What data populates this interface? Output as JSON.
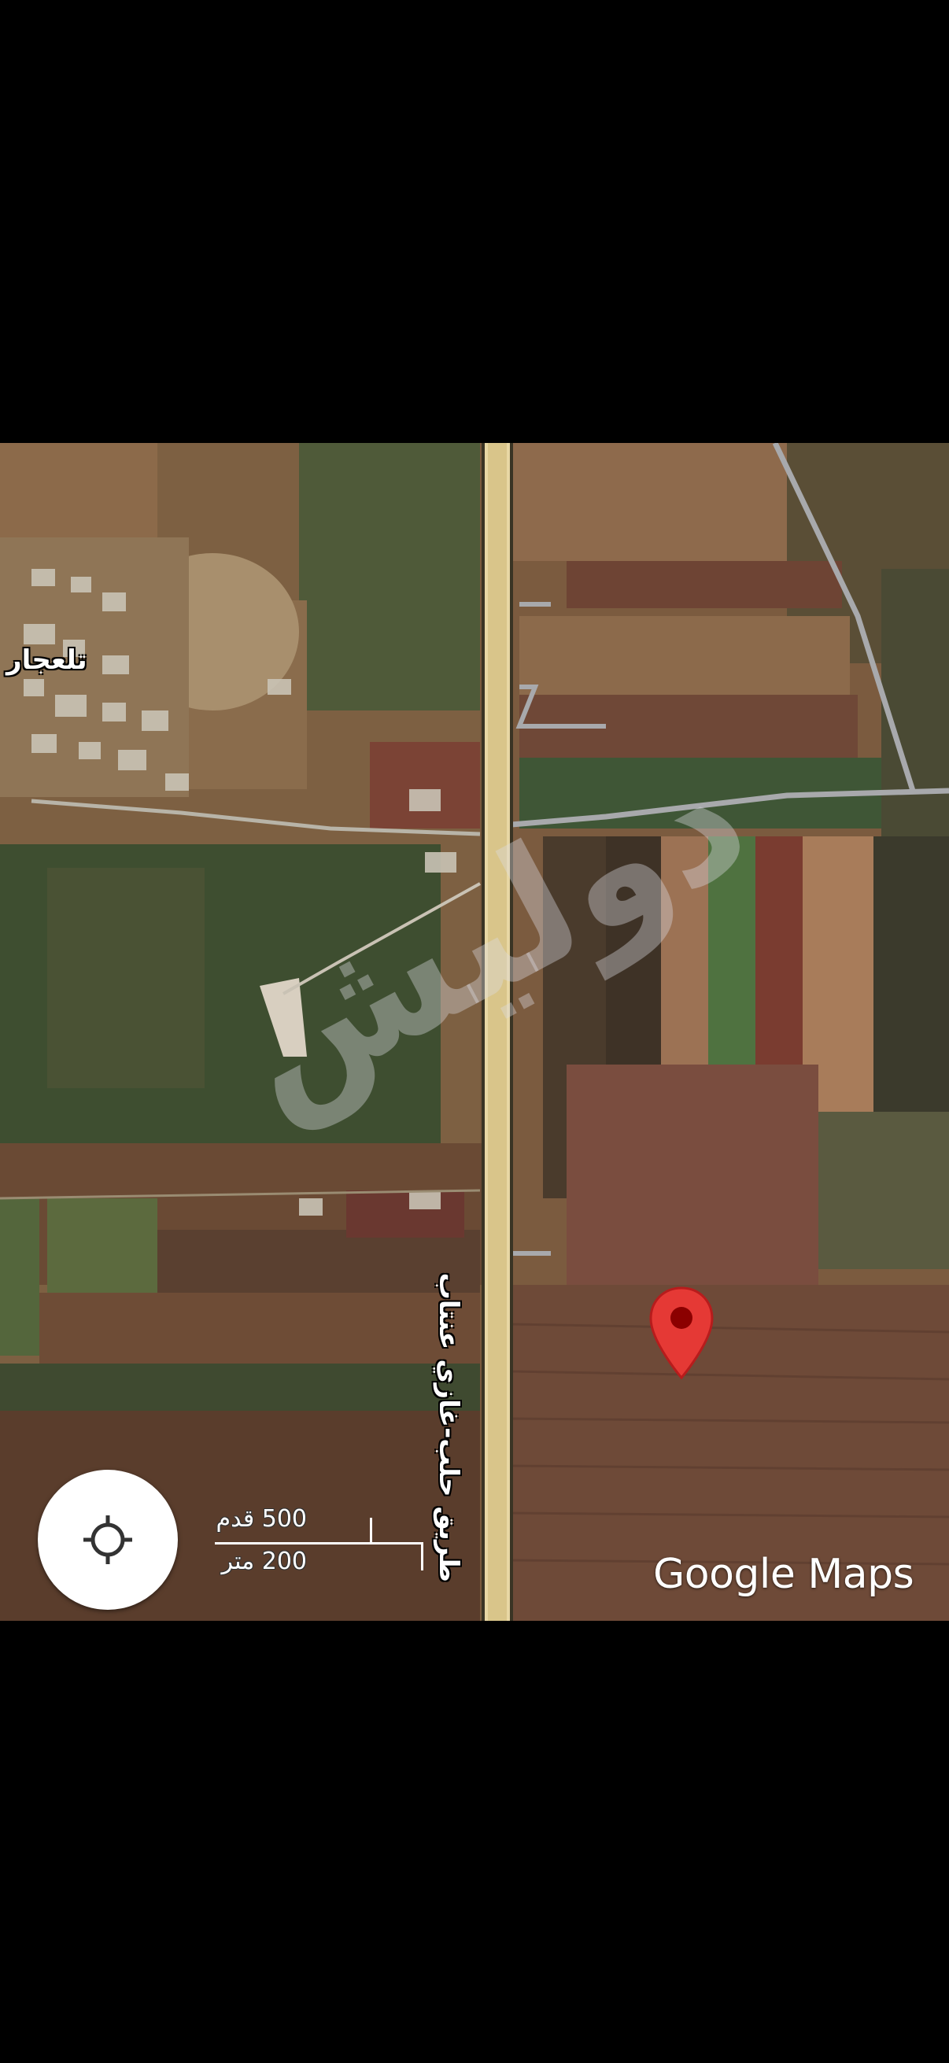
{
  "map": {
    "place_label": "تلعجار",
    "road_label": "طريق حلب-غازي عنتاب",
    "watermark": "دوليش",
    "scale": {
      "top_label": "500 قدم",
      "bottom_label": "200 متر"
    },
    "brand": "Google Maps",
    "locate_button": {
      "icon": "my-location-crosshair-icon"
    },
    "marker": {
      "icon": "red-location-pin-icon",
      "color": "#e53935"
    }
  }
}
